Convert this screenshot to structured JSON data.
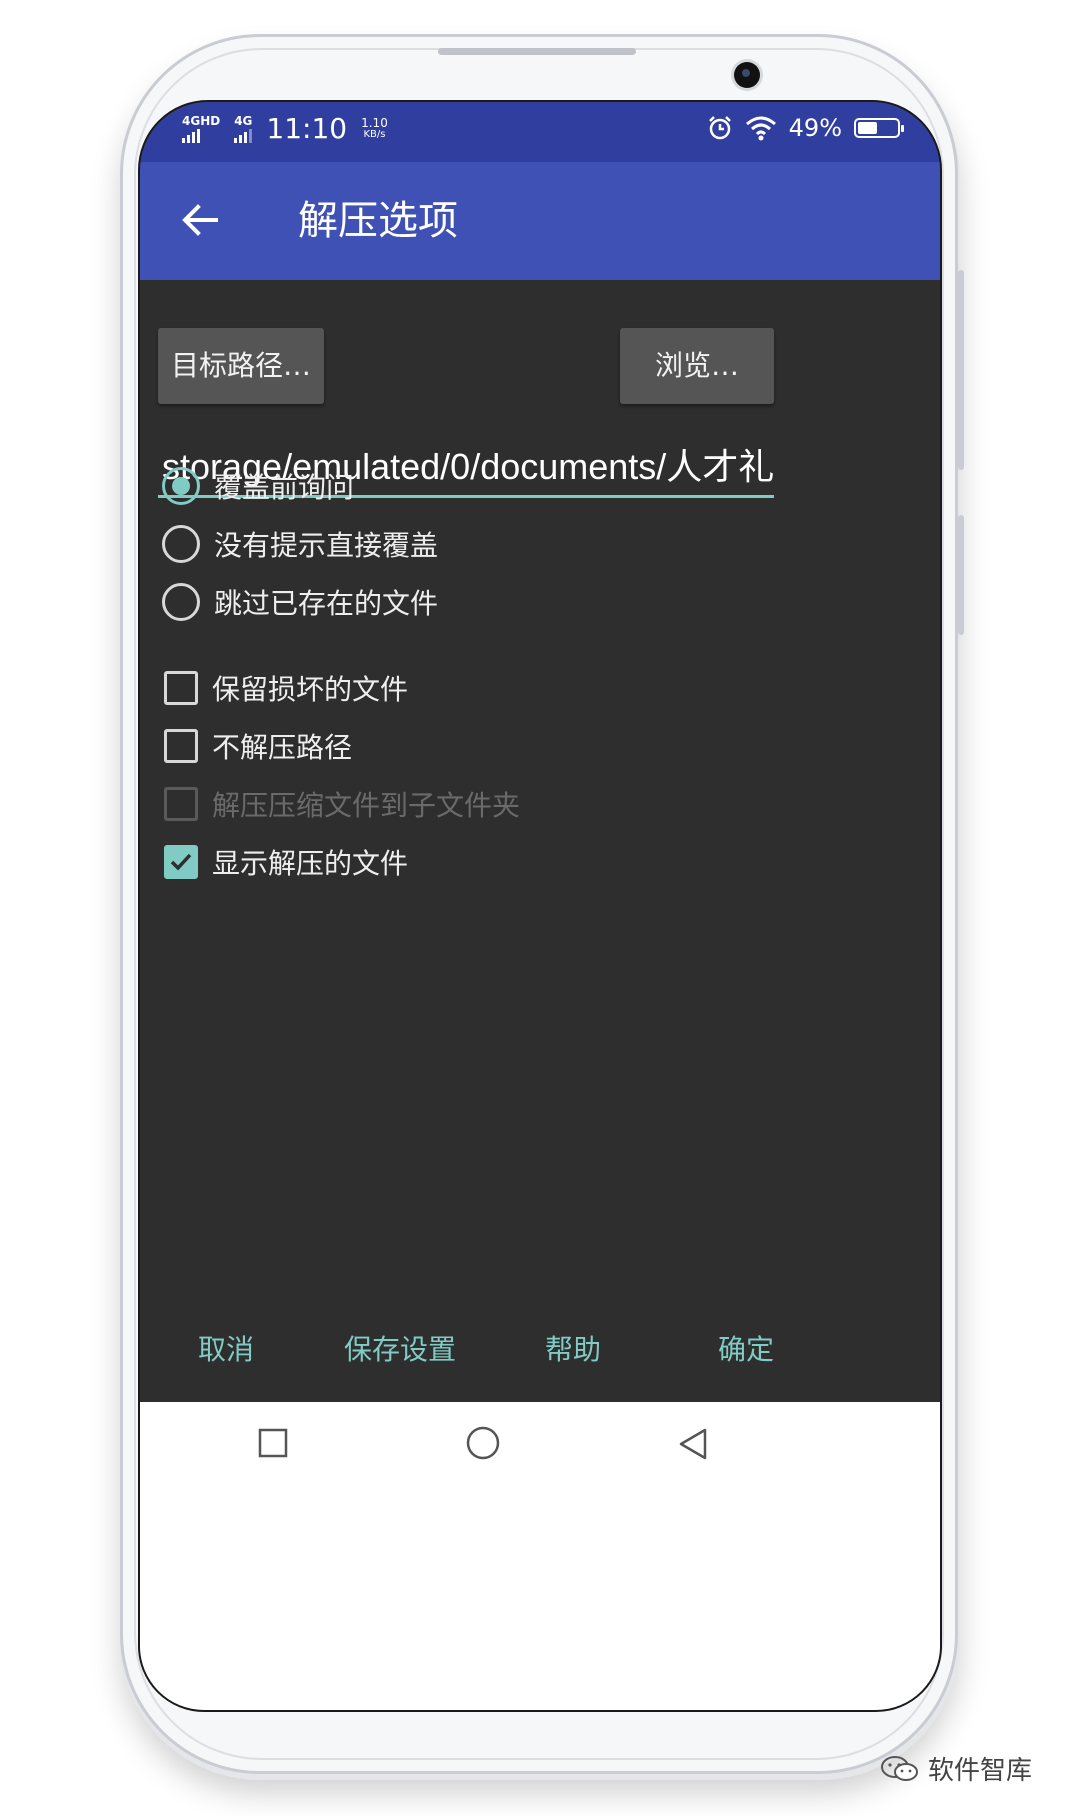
{
  "status_bar": {
    "network_1": "4GHD",
    "network_2": "4G",
    "time": "11:10",
    "speed_value": "1.10",
    "speed_unit": "KB/s",
    "battery_text": "49%",
    "battery_level": 0.49,
    "icons": [
      "signal-icon",
      "alarm-icon",
      "wifi-icon",
      "battery-icon"
    ]
  },
  "app_bar": {
    "title": "解压选项",
    "back_icon": "arrow-left-icon"
  },
  "dialog": {
    "target_path_button": "目标路径…",
    "browse_button": "浏览…",
    "path_value": "storage/emulated/0/documents/人才礼"
  },
  "radio_options": [
    {
      "label": "覆盖前询问",
      "selected": true
    },
    {
      "label": "没有提示直接覆盖",
      "selected": false
    },
    {
      "label": "跳过已存在的文件",
      "selected": false
    }
  ],
  "check_options": [
    {
      "label": "保留损坏的文件",
      "checked": false,
      "enabled": true
    },
    {
      "label": "不解压路径",
      "checked": false,
      "enabled": true
    },
    {
      "label": "解压压缩文件到子文件夹",
      "checked": false,
      "enabled": false
    },
    {
      "label": "显示解压的文件",
      "checked": true,
      "enabled": true
    }
  ],
  "footer": {
    "cancel": "取消",
    "save_settings": "保存设置",
    "help": "帮助",
    "ok": "确定"
  },
  "colors": {
    "status_bar": "#303f9f",
    "app_bar": "#3f51b5",
    "background": "#2e2e2e",
    "accent": "#80cbc4",
    "button": "#555555"
  },
  "watermark": "软件智库"
}
